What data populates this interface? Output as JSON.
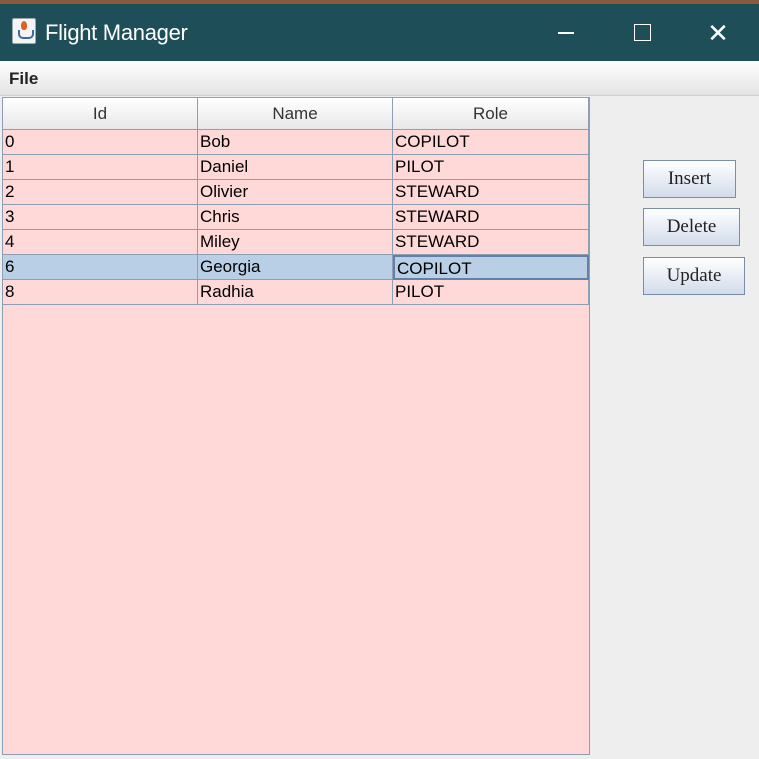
{
  "window": {
    "title": "Flight Manager"
  },
  "menu": {
    "file_label": "File"
  },
  "table": {
    "columns": [
      "Id",
      "Name",
      "Role"
    ],
    "rows": [
      [
        "0",
        "Bob",
        "COPILOT"
      ],
      [
        "1",
        "Daniel",
        "PILOT"
      ],
      [
        "2",
        "Olivier",
        "STEWARD"
      ],
      [
        "3",
        "Chris",
        "STEWARD"
      ],
      [
        "4",
        "Miley",
        "STEWARD"
      ],
      [
        "6",
        "Georgia",
        "COPILOT"
      ],
      [
        "8",
        "Radhia",
        "PILOT"
      ]
    ],
    "selected_row_index": 5
  },
  "buttons": {
    "insert": "Insert",
    "delete": "Delete",
    "update": "Update"
  },
  "colors": {
    "titlebar": "#1e4f58",
    "table_bg": "#ffd8d8",
    "selection": "#b8cfe5"
  }
}
